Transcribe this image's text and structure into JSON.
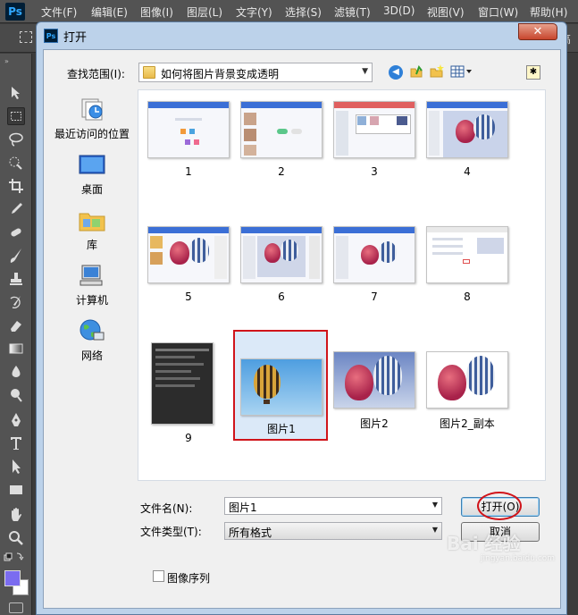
{
  "app": {
    "logo": "Ps",
    "menu": [
      "文件(F)",
      "编辑(E)",
      "图像(I)",
      "图层(L)",
      "文字(Y)",
      "选择(S)",
      "滤镜(T)",
      "3D(D)",
      "视图(V)",
      "窗口(W)",
      "帮助(H)"
    ],
    "options_right_text": "高"
  },
  "dialog": {
    "title": "打开",
    "close_label": "✕",
    "look_in_label": "查找范围(I):",
    "look_in_value": "如何将图片背景变成透明",
    "places": [
      {
        "label": "最近访问的位置",
        "icon": "recent-places-icon"
      },
      {
        "label": "桌面",
        "icon": "desktop-icon"
      },
      {
        "label": "库",
        "icon": "libraries-icon"
      },
      {
        "label": "计算机",
        "icon": "computer-icon"
      },
      {
        "label": "网络",
        "icon": "network-icon"
      }
    ],
    "files": [
      {
        "name": "1",
        "thumb": "web"
      },
      {
        "name": "2",
        "thumb": "web"
      },
      {
        "name": "3",
        "thumb": "web"
      },
      {
        "name": "4",
        "thumb": "web-balloons"
      },
      {
        "name": "5",
        "thumb": "web-balloons"
      },
      {
        "name": "6",
        "thumb": "web-balloons"
      },
      {
        "name": "7",
        "thumb": "web-balloons"
      },
      {
        "name": "8",
        "thumb": "dialog-balloons"
      },
      {
        "name": "9",
        "thumb": "dark-ui"
      },
      {
        "name": "图片1",
        "thumb": "single-balloon",
        "selected": true
      },
      {
        "name": "图片2",
        "thumb": "two-balloons"
      },
      {
        "name": "图片2_副本",
        "thumb": "two-balloons-white"
      }
    ],
    "file_name_label": "文件名(N):",
    "file_name_value": "图片1",
    "file_type_label": "文件类型(T):",
    "file_type_value": "所有格式",
    "open_button": "打开(O)",
    "cancel_button": "取消",
    "image_sequence_label": "图像序列",
    "image_sequence_checked": false
  },
  "watermark": {
    "text": "Bai 经验",
    "sub": "jingyan.baidu.com"
  }
}
